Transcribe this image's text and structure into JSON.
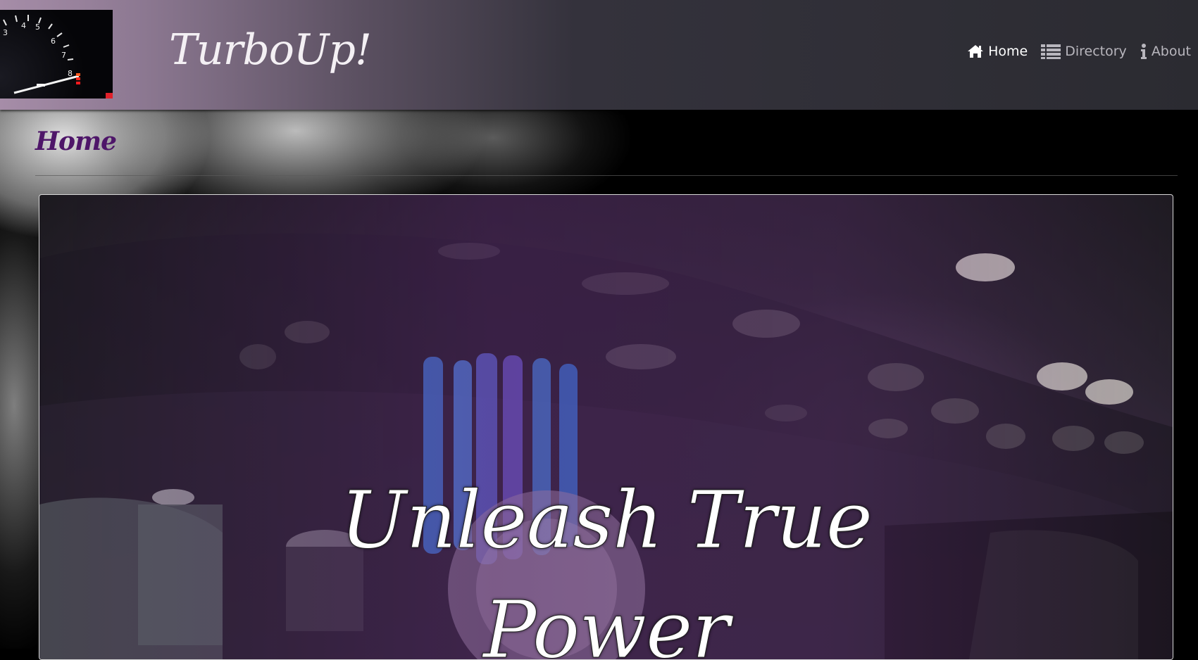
{
  "brand": {
    "name": "TurboUp!",
    "logo": "tachometer-logo"
  },
  "nav": {
    "items": [
      {
        "label": "Home",
        "icon": "home-icon",
        "active": true
      },
      {
        "label": "Directory",
        "icon": "list-icon",
        "active": false
      },
      {
        "label": "About",
        "icon": "info-icon",
        "active": false
      }
    ]
  },
  "page": {
    "heading": "Home"
  },
  "hero": {
    "title": "Unleash True Power"
  },
  "colors": {
    "heading": "#4e1669",
    "nav_active": "#ffffff",
    "nav_inactive": "#b8b6bd"
  }
}
